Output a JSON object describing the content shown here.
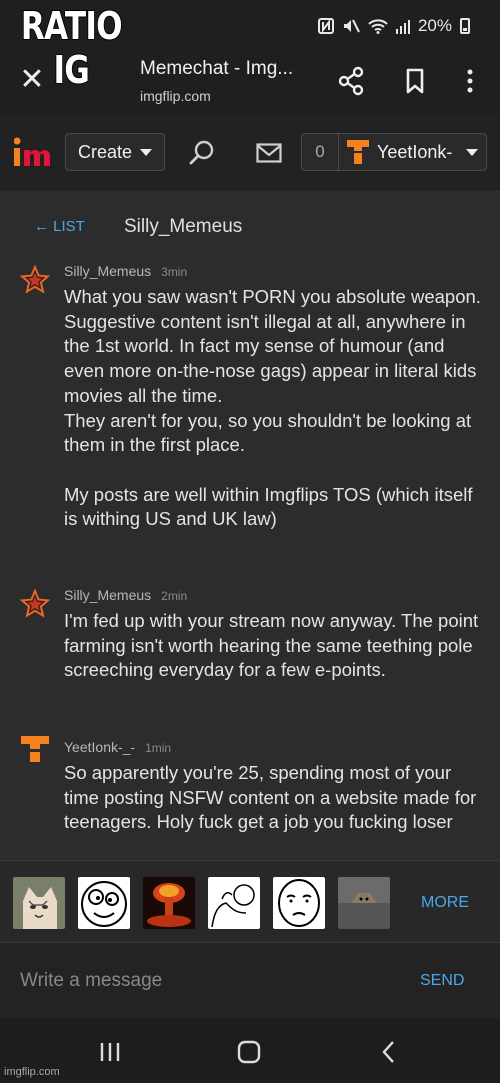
{
  "meme_caption": [
    "RATIO",
    "IG"
  ],
  "status_bar": {
    "battery": "20%"
  },
  "browser": {
    "title": "Memechat - Img...",
    "url": "imgflip.com"
  },
  "site_header": {
    "create_label": "Create",
    "notification_count": "0",
    "username": "YeetIonk-"
  },
  "chat": {
    "back_label": "← LIST",
    "partner": "Silly_Memeus"
  },
  "messages": [
    {
      "user": "Silly_Memeus",
      "time": "3min",
      "avatar": "star-icon",
      "text": "What you saw wasn't PORN you absolute weapon.\nSuggestive content isn't illegal at all, anywhere in the 1st world. In fact my sense of humour (and even more on-the-nose gags) appear in literal kids movies all the time.\nThey aren't for you, so you shouldn't be looking at them in the first place.\n\nMy posts are well within Imgflips TOS (which itself is withing US and UK law)"
    },
    {
      "user": "Silly_Memeus",
      "time": "2min",
      "avatar": "star-icon",
      "text": "I'm fed up with your stream now anyway. The point farming isn't worth hearing the same teething pole screeching everyday for a few e-points."
    },
    {
      "user": "YeetIonk-_-",
      "time": "1min",
      "avatar": "t-logo-icon",
      "text": "So apparently you're 25, spending most of your time posting NSFW content on a website made for teenagers. Holy fuck get a job you fucking loser"
    }
  ],
  "stickers": {
    "more_label": "MORE",
    "items": [
      "cat-sticker",
      "derp-face-sticker",
      "explosion-sticker",
      "comic-sticker",
      "okay-face-sticker",
      "ceiling-cat-sticker"
    ]
  },
  "composer": {
    "placeholder": "Write a message",
    "send_label": "SEND"
  },
  "watermark": "imgflip.com",
  "colors": {
    "accent_link": "#4aa8e8",
    "brand_orange": "#f5821f",
    "brand_red": "#e2143a",
    "background": "#2c2c2c"
  }
}
